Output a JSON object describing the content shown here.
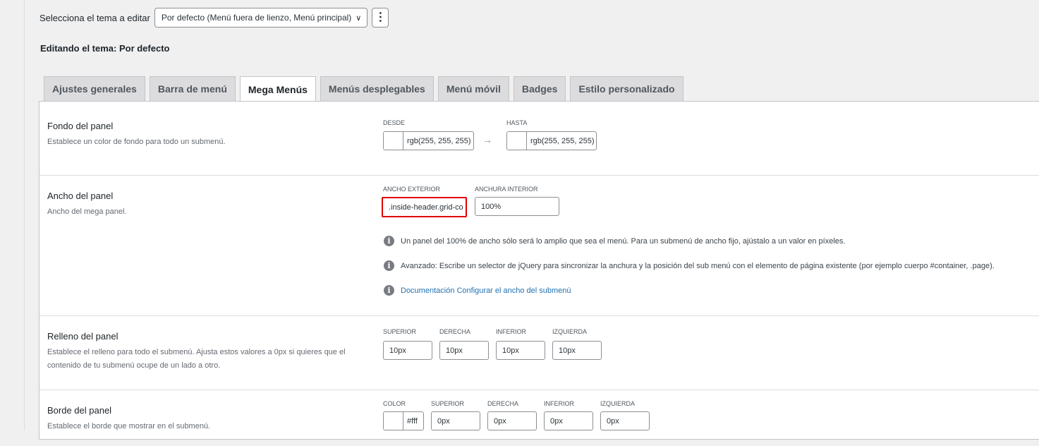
{
  "header": {
    "select_label": "Selecciona el tema a editar",
    "theme_value": "Por defecto (Menú fuera de lienzo, Menú principal)",
    "more_glyph": "⋮",
    "editing_title": "Editando el tema: Por defecto"
  },
  "tabs": [
    {
      "label": "Ajustes generales"
    },
    {
      "label": "Barra de menú"
    },
    {
      "label": "Mega Menús",
      "active": true
    },
    {
      "label": "Menús desplegables"
    },
    {
      "label": "Menú móvil"
    },
    {
      "label": "Badges"
    },
    {
      "label": "Estilo personalizado"
    }
  ],
  "rows": {
    "fondo": {
      "title": "Fondo del panel",
      "desc": "Establece un color de fondo para todo un submenú.",
      "from_label": "DESDE",
      "from_value": "rgb(255, 255, 255)",
      "to_label": "HASTA",
      "to_value": "rgb(255, 255, 255)",
      "arrow": "→"
    },
    "ancho": {
      "title": "Ancho del panel",
      "desc": "Ancho del mega panel.",
      "outer_label": "ANCHO EXTERIOR",
      "outer_value": ".inside-header.grid-co",
      "inner_label": "ANCHURA INTERIOR",
      "inner_value": "100%",
      "note1": "Un panel del 100% de ancho sólo será lo amplio que sea el menú. Para un submenú de ancho fijo, ajústalo a un valor en píxeles.",
      "note2": "Avanzado: Escribe un selector de jQuery para sincronizar la anchura y la posición del sub menú con el elemento de página existente (por ejemplo cuerpo #container, .page).",
      "doc_link": "Documentación Configurar el ancho del submenú"
    },
    "relleno": {
      "title": "Relleno del panel",
      "desc": "Establece el relleno para todo el submenú. Ajusta estos valores a 0px si quieres que el contenido de tu submenú ocupe de un lado a otro.",
      "fields": [
        {
          "label": "SUPERIOR",
          "value": "10px"
        },
        {
          "label": "DERECHA",
          "value": "10px"
        },
        {
          "label": "INFERIOR",
          "value": "10px"
        },
        {
          "label": "IZQUIERDA",
          "value": "10px"
        }
      ]
    },
    "borde": {
      "title": "Borde del panel",
      "desc": "Establece el borde que mostrar en el submenú.",
      "color_label": "COLOR",
      "color_value": "#fff",
      "fields": [
        {
          "label": "SUPERIOR",
          "value": "0px"
        },
        {
          "label": "DERECHA",
          "value": "0px"
        },
        {
          "label": "INFERIOR",
          "value": "0px"
        },
        {
          "label": "IZQUIERDA",
          "value": "0px"
        }
      ]
    }
  },
  "icons": {
    "info": "i"
  }
}
